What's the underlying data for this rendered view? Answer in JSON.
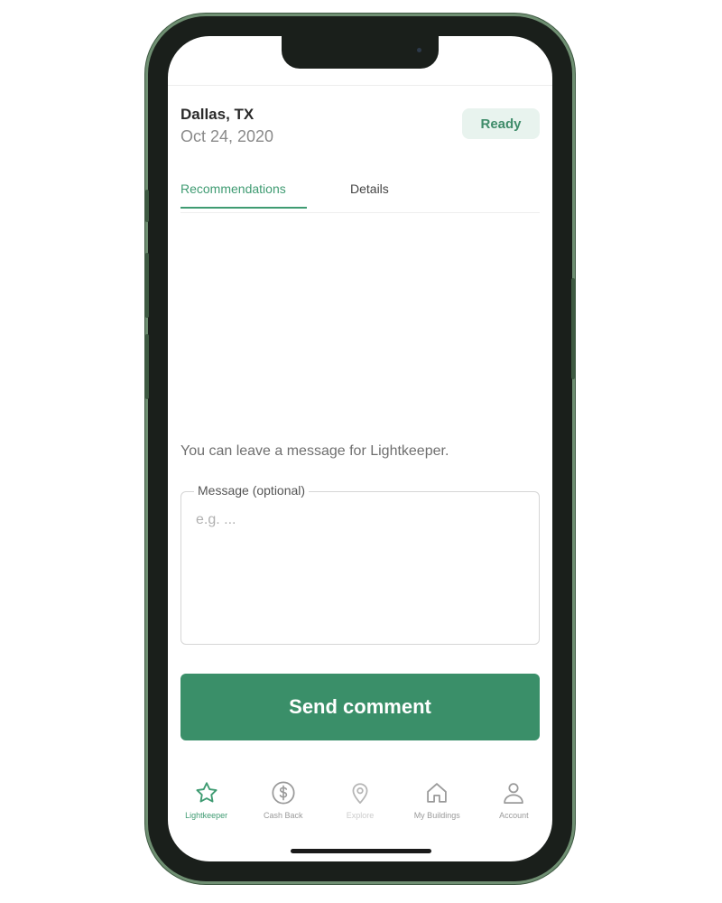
{
  "header": {
    "city": "Dallas, TX",
    "date": "Oct 24, 2020",
    "status_badge": "Ready"
  },
  "tabs": [
    {
      "label": "Recommendations",
      "active": true
    },
    {
      "label": "Details",
      "active": false
    }
  ],
  "comment": {
    "prompt": "You can leave a message for Lightkeeper.",
    "field_label": "Message (optional)",
    "placeholder": "e.g. ...",
    "value": "",
    "send_label": "Send comment"
  },
  "nav": [
    {
      "label": "Lightkeeper",
      "icon": "star-icon"
    },
    {
      "label": "Cash Back",
      "icon": "dollar-icon"
    },
    {
      "label": "Explore",
      "icon": "location-pin-icon"
    },
    {
      "label": "My Buildings",
      "icon": "home-icon"
    },
    {
      "label": "Account",
      "icon": "person-icon"
    }
  ],
  "colors": {
    "accent": "#3a8f69",
    "badge_bg": "#e8f3ee",
    "frame": "#1a1f1b"
  }
}
